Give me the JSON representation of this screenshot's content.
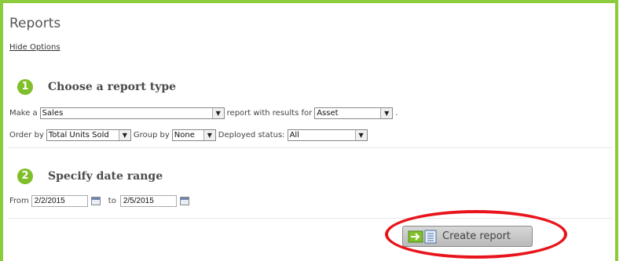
{
  "page": {
    "title": "Reports",
    "hide_options": "Hide Options"
  },
  "step1": {
    "number": "1",
    "heading": "Choose a report type",
    "make_a": "Make a",
    "report_type": "Sales",
    "results_for_text": "report with results for",
    "results_for": "Asset",
    "period": ".",
    "order_by_label": "Order by",
    "order_by": "Total Units Sold",
    "group_by_label": "Group by",
    "group_by": "None",
    "deployed_label": "Deployed status:",
    "deployed": "All"
  },
  "step2": {
    "number": "2",
    "heading": "Specify date range",
    "from_label": "From",
    "from_value": "2/2/2015",
    "to_label": "to",
    "to_value": "2/5/2015"
  },
  "actions": {
    "create_report": "Create report"
  },
  "colors": {
    "accent_green": "#7fbf2a",
    "frame_green": "#8ccc3c",
    "highlight_red": "#e8141b"
  }
}
